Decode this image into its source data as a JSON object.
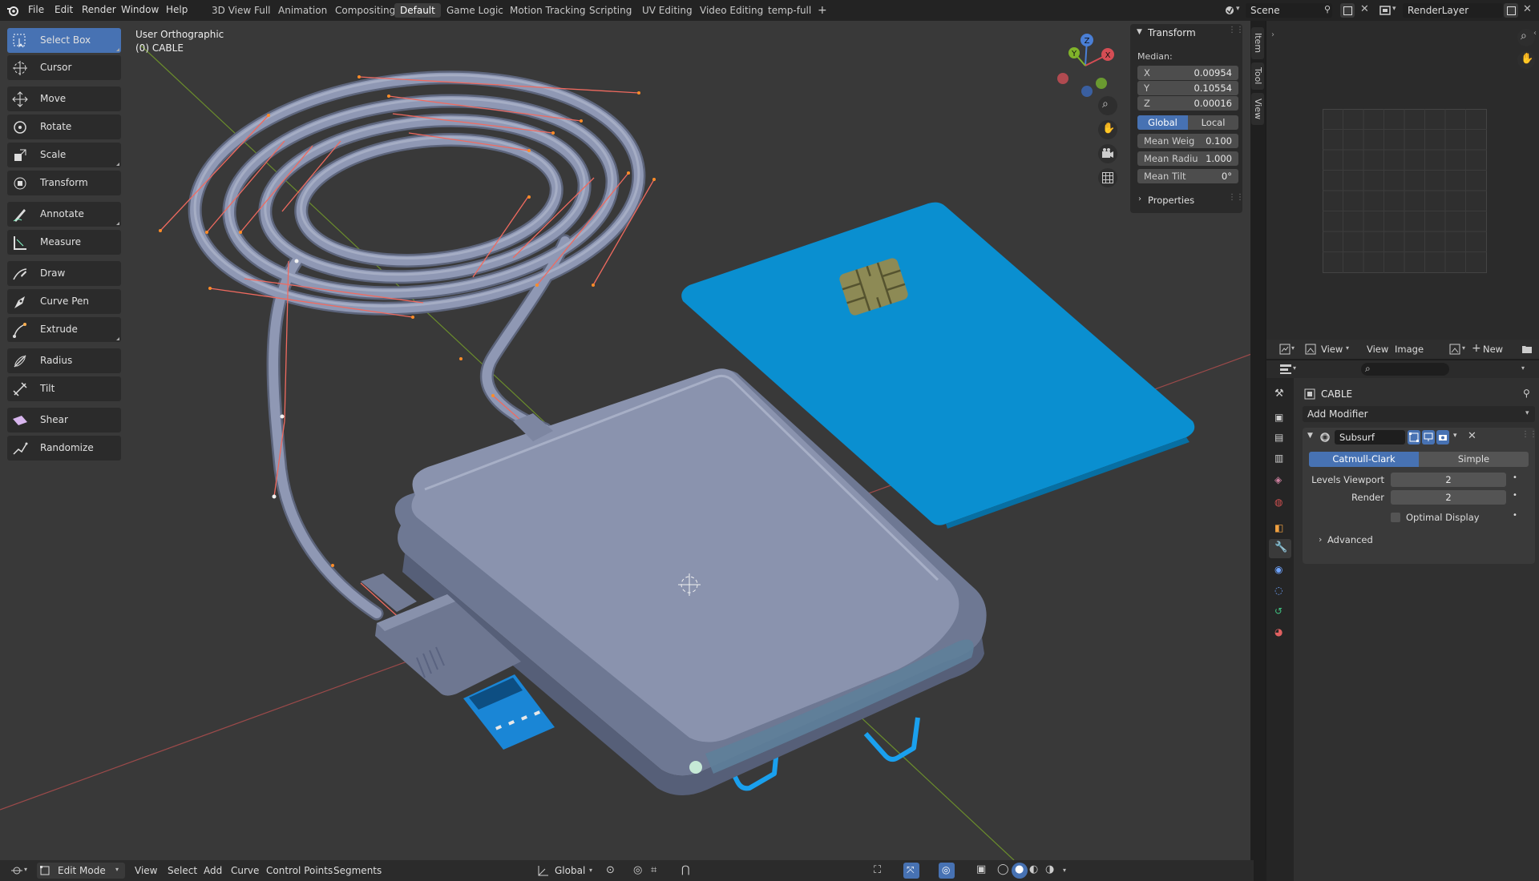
{
  "topbar": {
    "menus": [
      "File",
      "Edit",
      "Render",
      "Window",
      "Help"
    ],
    "workspaces": [
      "3D View Full",
      "Animation",
      "Compositing",
      "Default",
      "Game Logic",
      "Motion Tracking",
      "Scripting",
      "UV Editing",
      "Video Editing",
      "temp-full"
    ],
    "active_workspace": "Default",
    "add_workspace": "+",
    "scene": "Scene",
    "render_layer": "RenderLayer"
  },
  "viewport": {
    "view_name": "User Orthographic",
    "object_name": "(0) CABLE",
    "gizmo_axes": {
      "x": "X",
      "y": "Y",
      "z": "Z"
    }
  },
  "toolbar": {
    "tools": [
      {
        "label": "Select Box",
        "icon": "select-box-icon",
        "active": true
      },
      {
        "label": "Cursor",
        "icon": "cursor-icon"
      },
      {
        "label": "Move",
        "icon": "move-icon"
      },
      {
        "label": "Rotate",
        "icon": "rotate-icon"
      },
      {
        "label": "Scale",
        "icon": "scale-icon"
      },
      {
        "label": "Transform",
        "icon": "transform-icon"
      },
      {
        "label": "Annotate",
        "icon": "annotate-icon"
      },
      {
        "label": "Measure",
        "icon": "measure-icon"
      },
      {
        "label": "Draw",
        "icon": "draw-icon"
      },
      {
        "label": "Curve Pen",
        "icon": "curve-pen-icon"
      },
      {
        "label": "Extrude",
        "icon": "extrude-icon"
      },
      {
        "label": "Radius",
        "icon": "radius-icon"
      },
      {
        "label": "Tilt",
        "icon": "tilt-icon"
      },
      {
        "label": "Shear",
        "icon": "shear-icon"
      },
      {
        "label": "Randomize",
        "icon": "randomize-icon"
      }
    ]
  },
  "npanel": {
    "title": "Transform",
    "median_label": "Median:",
    "x_label": "X",
    "x_value": "0.00954",
    "y_label": "Y",
    "y_value": "0.10554",
    "z_label": "Z",
    "z_value": "0.00016",
    "global_label": "Global",
    "local_label": "Local",
    "mean_weight_label": "Mean Weig",
    "mean_weight_value": "0.100",
    "mean_radius_label": "Mean Radiu",
    "mean_radius_value": "1.000",
    "mean_tilt_label": "Mean Tilt",
    "mean_tilt_value": "0°",
    "properties_label": "Properties",
    "tabs": [
      "Item",
      "Tool",
      "View"
    ]
  },
  "image_editor": {
    "view_menu": "View",
    "menus": [
      "View",
      "Image"
    ],
    "new_label": "New"
  },
  "properties": {
    "object_name": "CABLE",
    "add_modifier": "Add Modifier",
    "modifier_name": "Subsurf",
    "catmull_clark": "Catmull-Clark",
    "simple": "Simple",
    "levels_viewport_label": "Levels Viewport",
    "levels_viewport_value": "2",
    "render_label": "Render",
    "render_value": "2",
    "optimal_display_label": "Optimal Display",
    "advanced_label": "Advanced"
  },
  "bottombar": {
    "mode": "Edit Mode",
    "menus": [
      "View",
      "Select",
      "Add",
      "Curve",
      "Control Points",
      "Segments"
    ],
    "orientation": "Global"
  },
  "colors": {
    "accent": "#4772b3",
    "card": "#0a8fd0",
    "usb_blue": "#1a86d6",
    "reader_body": "#8a93ae",
    "handle_line": "#f06a5f",
    "handle_point": "#ff8c28"
  }
}
